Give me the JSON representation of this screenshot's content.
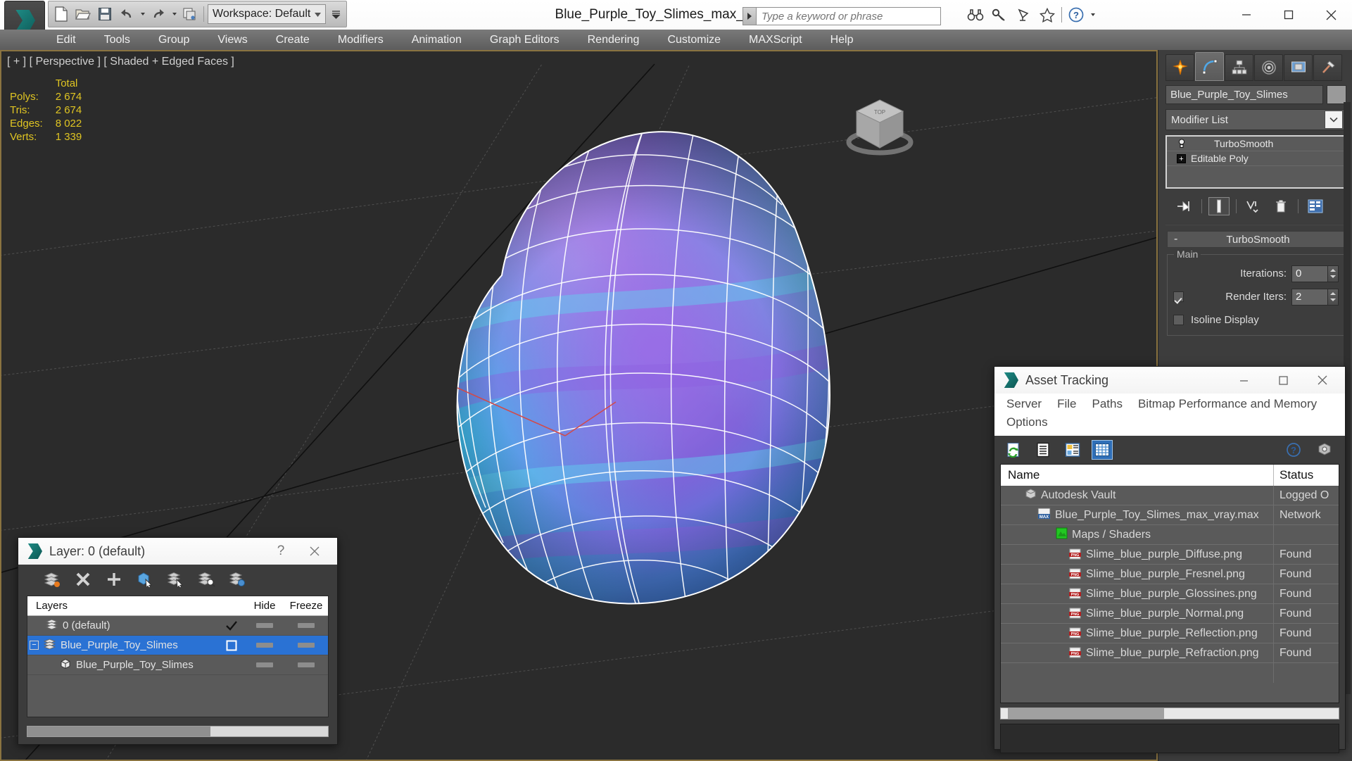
{
  "app": {
    "title": "Blue_Purple_Toy_Slimes_max_vray.max",
    "workspace": "Workspace: Default",
    "search_placeholder": "Type a keyword or phrase",
    "logo_icon": "autodesk-max-logo-icon"
  },
  "quick_access": [
    {
      "name": "new-file-button",
      "icon": "new-file-icon"
    },
    {
      "name": "open-file-button",
      "icon": "open-folder-icon"
    },
    {
      "name": "save-file-button",
      "icon": "save-disk-icon"
    },
    {
      "name": "undo-button",
      "icon": "undo-arrow-icon"
    },
    {
      "name": "redo-button",
      "icon": "redo-arrow-icon"
    },
    {
      "name": "set-project-folder-button",
      "icon": "project-folder-icon"
    }
  ],
  "title_icons": [
    {
      "name": "search-binoculars-icon"
    },
    {
      "name": "key-icon"
    },
    {
      "name": "satellite-dish-icon"
    },
    {
      "name": "favorites-star-icon"
    },
    {
      "name": "help-question-icon"
    }
  ],
  "window_buttons": {
    "minimize": "minimize-button",
    "maximize": "maximize-button",
    "close": "close-button"
  },
  "menu": [
    "Edit",
    "Tools",
    "Group",
    "Views",
    "Create",
    "Modifiers",
    "Animation",
    "Graph Editors",
    "Rendering",
    "Customize",
    "MAXScript",
    "Help"
  ],
  "viewport": {
    "label": "[ + ] [ Perspective ] [ Shaded + Edged Faces ]",
    "stats": {
      "header": "Total",
      "rows": [
        {
          "label": "Polys:",
          "value": "2 674"
        },
        {
          "label": "Tris:",
          "value": "2 674"
        },
        {
          "label": "Edges:",
          "value": "8 022"
        },
        {
          "label": "Verts:",
          "value": "1 339"
        }
      ]
    },
    "stat_color": "#e0c522",
    "background": "#2b2b2b",
    "viewcube_label": "TOP"
  },
  "command_panel": {
    "tabs": [
      {
        "name": "create-tab",
        "icon": "star-burst-icon",
        "active": false
      },
      {
        "name": "modify-tab",
        "icon": "curve-arc-icon",
        "active": true
      },
      {
        "name": "hierarchy-tab",
        "icon": "hierarchy-tree-icon",
        "active": false
      },
      {
        "name": "motion-tab",
        "icon": "motion-wheel-icon",
        "active": false
      },
      {
        "name": "display-tab",
        "icon": "display-monitor-icon",
        "active": false
      },
      {
        "name": "utilities-tab",
        "icon": "hammer-icon",
        "active": false
      }
    ],
    "object_name": "Blue_Purple_Toy_Slimes",
    "object_color": "#9a9a9a",
    "modifier_list_label": "Modifier List",
    "stack": [
      {
        "label": "TurboSmooth",
        "icon": "light-bulb-icon"
      },
      {
        "label": "Editable Poly",
        "icon": "plus-box-icon"
      }
    ],
    "stack_buttons": [
      {
        "name": "pin-stack-button",
        "icon": "pin-icon"
      },
      {
        "name": "show-end-result-button",
        "icon": "show-end-result-icon"
      },
      {
        "name": "make-unique-button",
        "icon": "make-unique-icon"
      },
      {
        "name": "remove-modifier-button",
        "icon": "trash-can-icon"
      },
      {
        "name": "configure-modifier-sets-button",
        "icon": "configure-sets-icon"
      }
    ],
    "rollout": {
      "title": "TurboSmooth",
      "collapse_glyph": "-",
      "group_title": "Main",
      "iterations_label": "Iterations:",
      "iterations_value": "0",
      "render_iters_label": "Render Iters:",
      "render_iters_value": "2",
      "render_iters_checked": true,
      "isoline_label": "Isoline Display",
      "isoline_checked": false
    }
  },
  "layer_dialog": {
    "title": "Layer: 0 (default)",
    "help_glyph": "?",
    "close_glyph": "×",
    "toolbar": [
      {
        "name": "create-new-layer-button",
        "icon": "new-layer-icon"
      },
      {
        "name": "delete-layer-button",
        "icon": "delete-x-icon"
      },
      {
        "name": "add-layer-button",
        "icon": "plus-icon"
      },
      {
        "name": "add-selection-to-layer-button",
        "icon": "cube-cursor-icon"
      },
      {
        "name": "select-objects-in-layer-button",
        "icon": "layers-cursor-icon"
      },
      {
        "name": "highlight-selected-objects-button",
        "icon": "layers-search-icon"
      },
      {
        "name": "layer-properties-button",
        "icon": "layers-gear-icon"
      }
    ],
    "columns": {
      "name": "Layers",
      "hide": "Hide",
      "freeze": "Freeze"
    },
    "rows": [
      {
        "label": "0 (default)",
        "icon": "layer-stack-icon",
        "indent": 0,
        "selected": false,
        "marker": "check",
        "expander": false
      },
      {
        "label": "Blue_Purple_Toy_Slimes",
        "icon": "layer-stack-icon",
        "indent": 0,
        "selected": true,
        "marker": "square",
        "expander": true
      },
      {
        "label": "Blue_Purple_Toy_Slimes",
        "icon": "object-cube-icon",
        "indent": 1,
        "selected": false,
        "marker": "none",
        "expander": false
      }
    ]
  },
  "asset_dialog": {
    "title": "Asset Tracking",
    "icon": "autodesk-max-logo-icon",
    "menus": [
      "Server",
      "File",
      "Paths",
      "Bitmap Performance and Memory",
      "Options"
    ],
    "toolbar": [
      {
        "name": "refresh-button",
        "icon": "refresh-page-icon",
        "active": false
      },
      {
        "name": "list-view-button",
        "icon": "list-lines-icon",
        "active": false
      },
      {
        "name": "details-view-button",
        "icon": "details-view-icon",
        "active": false
      },
      {
        "name": "grid-view-button",
        "icon": "grid-table-icon",
        "active": true
      }
    ],
    "toolbar_right": [
      {
        "name": "help-button",
        "icon": "help-question-icon"
      },
      {
        "name": "vault-help-button",
        "icon": "vault-icon"
      }
    ],
    "columns": {
      "name": "Name",
      "status": "Status"
    },
    "rows": [
      {
        "name": "Autodesk Vault",
        "status": "Logged O",
        "icon": "vault-cube-icon",
        "indent": 1
      },
      {
        "name": "Blue_Purple_Toy_Slimes_max_vray.max",
        "status": "Network",
        "icon": "max-file-icon",
        "indent": 2
      },
      {
        "name": "Maps / Shaders",
        "status": "",
        "icon": "maps-shaders-icon",
        "indent": 3
      },
      {
        "name": "Slime_blue_purple_Diffuse.png",
        "status": "Found",
        "icon": "png-file-icon",
        "indent": 4
      },
      {
        "name": "Slime_blue_purple_Fresnel.png",
        "status": "Found",
        "icon": "png-file-icon",
        "indent": 4
      },
      {
        "name": "Slime_blue_purple_Glossines.png",
        "status": "Found",
        "icon": "png-file-icon",
        "indent": 4
      },
      {
        "name": "Slime_blue_purple_Normal.png",
        "status": "Found",
        "icon": "png-file-icon",
        "indent": 4
      },
      {
        "name": "Slime_blue_purple_Reflection.png",
        "status": "Found",
        "icon": "png-file-icon",
        "indent": 4
      },
      {
        "name": "Slime_blue_purple_Refraction.png",
        "status": "Found",
        "icon": "png-file-icon",
        "indent": 4
      }
    ]
  },
  "colors": {
    "accent_selection": "#2a72d4",
    "viewport_bg": "#2b2b2b",
    "panel_bg": "#3d3d3d",
    "stats_yellow": "#e0c522",
    "viewport_border": "#8a7340"
  }
}
